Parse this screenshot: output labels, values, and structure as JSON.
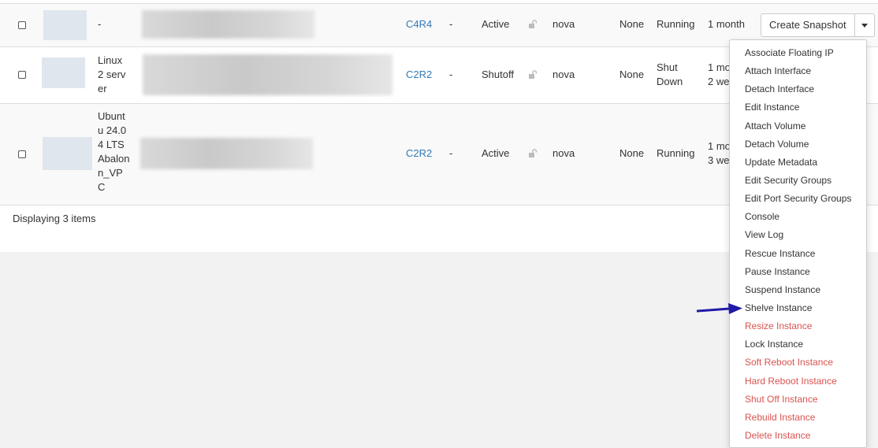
{
  "rows": [
    {
      "name": [
        "-"
      ],
      "flavor": "C4R4",
      "key_pair": "-",
      "status": "Active",
      "availability_zone": "nova",
      "task": "None",
      "power_state": [
        "Running"
      ],
      "age": [
        "1 month"
      ]
    },
    {
      "name": [
        "Linux",
        "2 serv",
        "er"
      ],
      "flavor": "C2R2",
      "key_pair": "-",
      "status": "Shutoff",
      "availability_zone": "nova",
      "task": "None",
      "power_state": [
        "Shut",
        "Down"
      ],
      "age": [
        "1 mo",
        "2 we"
      ]
    },
    {
      "name": [
        "Ubunt",
        "u 24.0",
        "4 LTS",
        "Abalon",
        "n_VP",
        "C"
      ],
      "flavor": "C2R2",
      "key_pair": "-",
      "status": "Active",
      "availability_zone": "nova",
      "task": "None",
      "power_state": [
        "Running"
      ],
      "age": [
        "1 mo",
        "3 we"
      ]
    }
  ],
  "footer": {
    "count_text": "Displaying 3 items"
  },
  "actions": {
    "primary_label": "Create Snapshot",
    "menu": [
      {
        "label": "Associate Floating IP",
        "danger": false
      },
      {
        "label": "Attach Interface",
        "danger": false
      },
      {
        "label": "Detach Interface",
        "danger": false
      },
      {
        "label": "Edit Instance",
        "danger": false
      },
      {
        "label": "Attach Volume",
        "danger": false
      },
      {
        "label": "Detach Volume",
        "danger": false
      },
      {
        "label": "Update Metadata",
        "danger": false
      },
      {
        "label": "Edit Security Groups",
        "danger": false
      },
      {
        "label": "Edit Port Security Groups",
        "danger": false
      },
      {
        "label": "Console",
        "danger": false
      },
      {
        "label": "View Log",
        "danger": false
      },
      {
        "label": "Rescue Instance",
        "danger": false
      },
      {
        "label": "Pause Instance",
        "danger": false
      },
      {
        "label": "Suspend Instance",
        "danger": false
      },
      {
        "label": "Shelve Instance",
        "danger": false
      },
      {
        "label": "Resize Instance",
        "danger": true
      },
      {
        "label": "Lock Instance",
        "danger": false
      },
      {
        "label": "Soft Reboot Instance",
        "danger": true
      },
      {
        "label": "Hard Reboot Instance",
        "danger": true
      },
      {
        "label": "Shut Off Instance",
        "danger": true
      },
      {
        "label": "Rebuild Instance",
        "danger": true
      },
      {
        "label": "Delete Instance",
        "danger": true
      }
    ]
  },
  "colors": {
    "link": "#337ab7",
    "danger": "#d9534f",
    "arrow": "#1f1aa8"
  },
  "icons": {
    "lock": "unlocked-padlock-icon",
    "arrow": "pointer-arrow-icon"
  }
}
